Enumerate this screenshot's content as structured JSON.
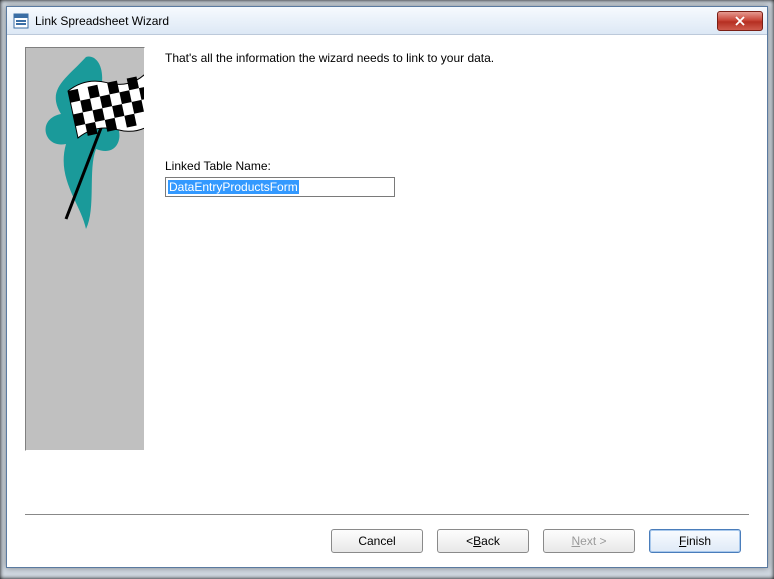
{
  "window": {
    "title": "Link Spreadsheet Wizard"
  },
  "main": {
    "info_text": "That's all the information the wizard needs to link to your data.",
    "field_label": "Linked Table Name:",
    "field_value": "DataEntryProductsForm"
  },
  "buttons": {
    "cancel": "Cancel",
    "back_prefix": "< ",
    "back_letter": "B",
    "back_rest": "ack",
    "next_letter": "N",
    "next_rest": "ext >",
    "finish_letter": "F",
    "finish_rest": "inish"
  }
}
